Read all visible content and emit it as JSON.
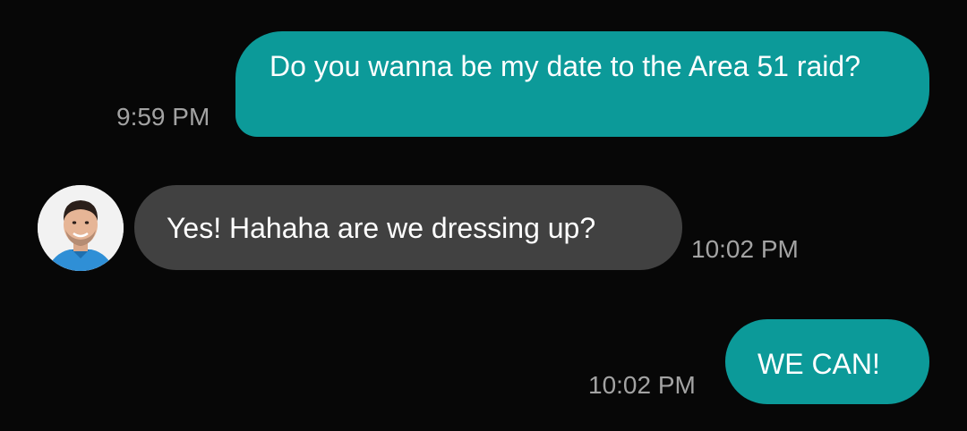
{
  "conversation": {
    "messages": [
      {
        "direction": "sent",
        "text": "Do you wanna be my date to the Area 51 raid?",
        "time": "9:59 PM"
      },
      {
        "direction": "received",
        "text": "Yes! Hahaha are we dressing up?",
        "time": "10:02 PM",
        "avatar_icon": "contact-avatar-icon"
      },
      {
        "direction": "sent",
        "text": "WE CAN!",
        "time": "10:02 PM"
      }
    ]
  },
  "colors": {
    "background": "#070707",
    "sent_bubble": "#0c9a99",
    "received_bubble": "#414141",
    "message_text": "#ffffff",
    "timestamp_text": "#a3a3a3"
  }
}
